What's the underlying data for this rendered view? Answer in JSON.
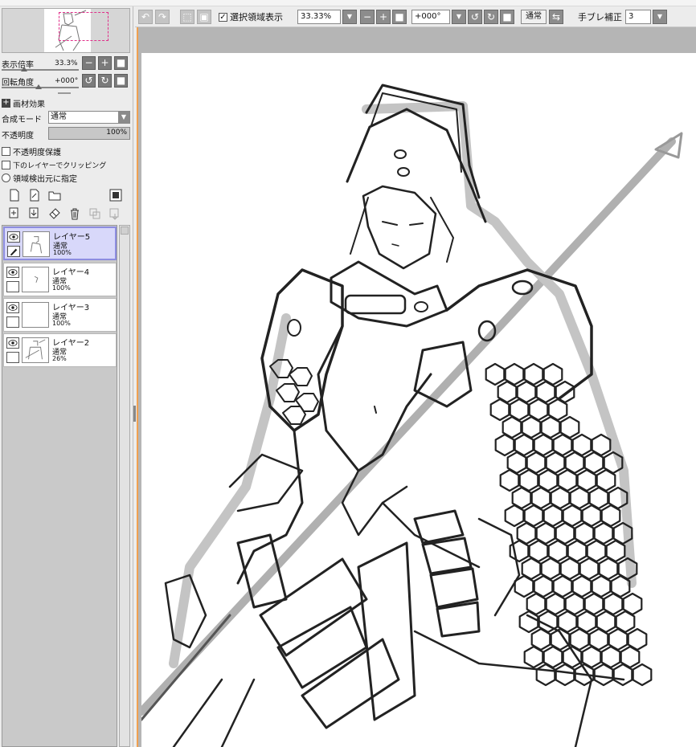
{
  "toolbar": {
    "selection_show_label": "選択領域表示",
    "zoom_value": "33.33%",
    "rotate_value": "+000°",
    "blend_button": "通常",
    "stabilizer_label": "手ブレ補正",
    "stabilizer_value": "3"
  },
  "navigator": {
    "zoom_label": "表示倍率",
    "zoom_value": "33.3%",
    "rotation_label": "回転角度",
    "rotation_value": "+000°"
  },
  "panel": {
    "texture_label": "画材効果",
    "blend_mode_label": "合成モード",
    "blend_mode_value": "通常",
    "opacity_label": "不透明度",
    "opacity_value": "100%",
    "preserve_opacity": "不透明度保護",
    "clip_to_lower": "下のレイヤーでクリッピング",
    "selection_source": "領域検出元に指定"
  },
  "layers": [
    {
      "name": "レイヤー5",
      "mode": "通常",
      "opacity": "100%",
      "active": true
    },
    {
      "name": "レイヤー4",
      "mode": "通常",
      "opacity": "100%",
      "active": false
    },
    {
      "name": "レイヤー3",
      "mode": "通常",
      "opacity": "100%",
      "active": false
    },
    {
      "name": "レイヤー2",
      "mode": "通常",
      "opacity": "26%",
      "active": false
    }
  ],
  "icons": {
    "undo": "undo-icon",
    "redo": "redo-icon",
    "zoom_minus": "minus-icon",
    "zoom_plus": "plus-icon",
    "zoom_reset": "stop-icon",
    "rotate_left": "rotate-left-icon",
    "rotate_right": "rotate-right-icon"
  },
  "colors": {
    "active_layer_bg": "#d8d8fa",
    "active_layer_border": "#8d8de0",
    "canvas_frame": "#f0a050",
    "nav_view_rect": "#e0308a"
  }
}
